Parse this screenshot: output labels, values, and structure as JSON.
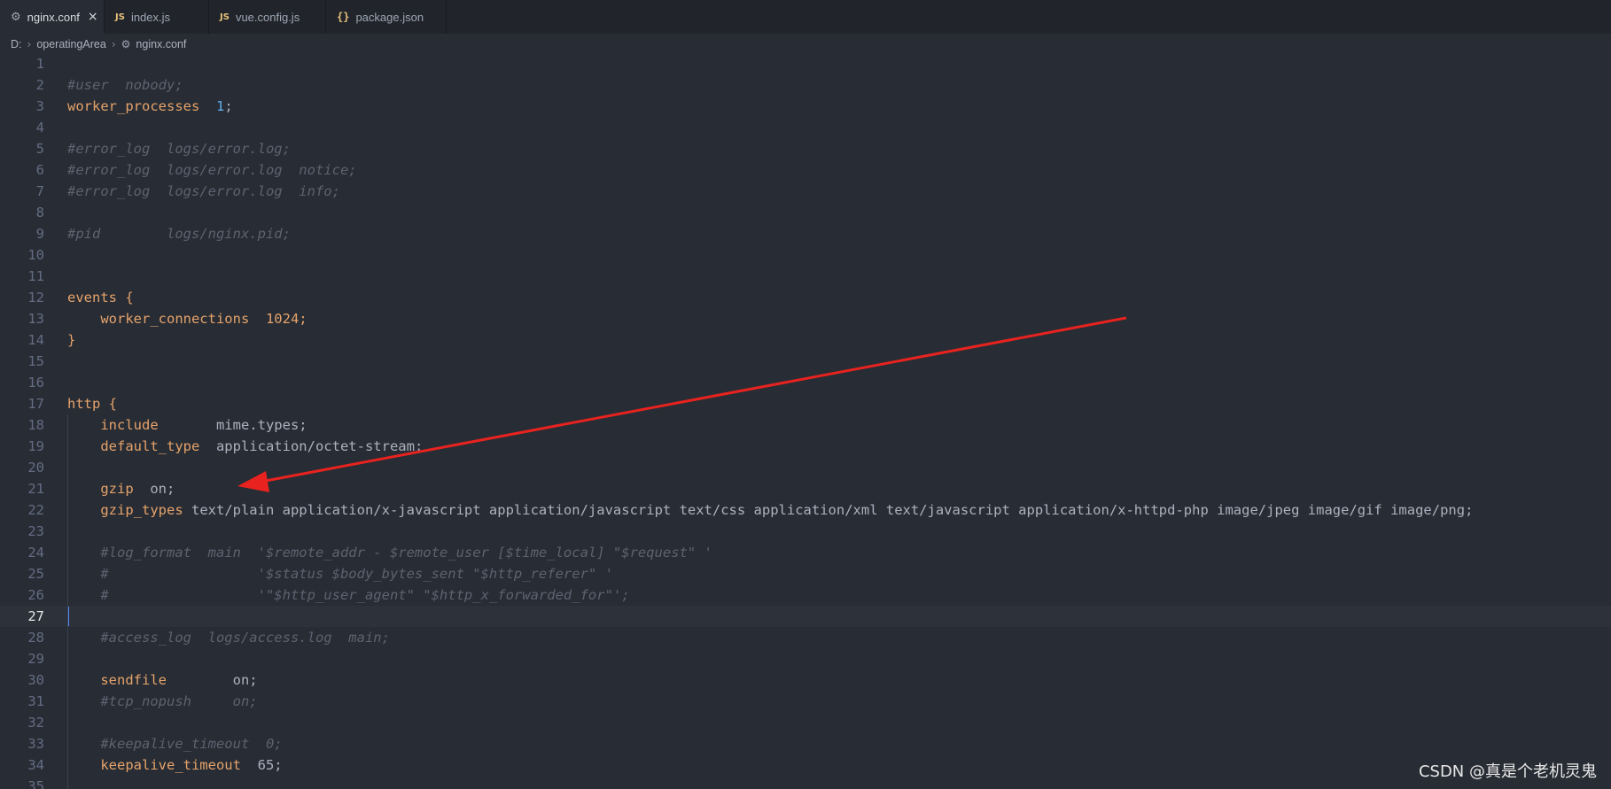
{
  "tabs": [
    {
      "icon": "gear-icon",
      "glyph": "⚙",
      "label": "nginx.conf",
      "active": true,
      "close": "×"
    },
    {
      "icon": "js-file-icon",
      "glyph": "JS",
      "label": "index.js",
      "active": false
    },
    {
      "icon": "js-file-icon",
      "glyph": "JS",
      "label": "vue.config.js",
      "active": false
    },
    {
      "icon": "json-file-icon",
      "glyph": "{}",
      "label": "package.json",
      "active": false
    }
  ],
  "breadcrumb": {
    "drive": "D:",
    "folder": "operatingArea",
    "file": "nginx.conf",
    "separator": "›",
    "file_icon": "⚙"
  },
  "editor": {
    "current_line": 27,
    "lines": [
      {
        "n": "1",
        "parts": []
      },
      {
        "n": "2",
        "parts": [
          {
            "t": "#user  nobody;",
            "s": "c"
          }
        ]
      },
      {
        "n": "3",
        "parts": [
          {
            "t": "worker_processes",
            "s": "k"
          },
          {
            "t": "  ",
            "s": "p"
          },
          {
            "t": "1",
            "s": "n"
          },
          {
            "t": ";",
            "s": "p"
          }
        ]
      },
      {
        "n": "4",
        "parts": []
      },
      {
        "n": "5",
        "parts": [
          {
            "t": "#error_log  logs/error.log;",
            "s": "c"
          }
        ]
      },
      {
        "n": "6",
        "parts": [
          {
            "t": "#error_log  logs/error.log  notice;",
            "s": "c"
          }
        ]
      },
      {
        "n": "7",
        "parts": [
          {
            "t": "#error_log  logs/error.log  info;",
            "s": "c"
          }
        ]
      },
      {
        "n": "8",
        "parts": []
      },
      {
        "n": "9",
        "parts": [
          {
            "t": "#pid        logs/nginx.pid;",
            "s": "c"
          }
        ]
      },
      {
        "n": "10",
        "parts": []
      },
      {
        "n": "11",
        "parts": []
      },
      {
        "n": "12",
        "parts": [
          {
            "t": "events {",
            "s": "k"
          }
        ]
      },
      {
        "n": "13",
        "parts": [
          {
            "t": "    ",
            "s": "p"
          },
          {
            "t": "worker_connections",
            "s": "k"
          },
          {
            "t": "  1024;",
            "s": "k"
          }
        ]
      },
      {
        "n": "14",
        "parts": [
          {
            "t": "}",
            "s": "k"
          }
        ]
      },
      {
        "n": "15",
        "parts": []
      },
      {
        "n": "16",
        "parts": []
      },
      {
        "n": "17",
        "parts": [
          {
            "t": "http {",
            "s": "k"
          }
        ]
      },
      {
        "n": "18",
        "parts": [
          {
            "t": "    ",
            "s": "p"
          },
          {
            "t": "include",
            "s": "k"
          },
          {
            "t": "       mime.types;",
            "s": "p"
          }
        ]
      },
      {
        "n": "19",
        "parts": [
          {
            "t": "    ",
            "s": "p"
          },
          {
            "t": "default_type",
            "s": "k"
          },
          {
            "t": "  application/octet-stream;",
            "s": "p"
          }
        ]
      },
      {
        "n": "20",
        "parts": []
      },
      {
        "n": "21",
        "parts": [
          {
            "t": "    ",
            "s": "p"
          },
          {
            "t": "gzip",
            "s": "k"
          },
          {
            "t": "  on;",
            "s": "p"
          }
        ]
      },
      {
        "n": "22",
        "parts": [
          {
            "t": "    ",
            "s": "p"
          },
          {
            "t": "gzip_types",
            "s": "k"
          },
          {
            "t": " text/plain application/x-javascript application/javascript text/css application/xml text/javascript application/x-httpd-php image/jpeg image/gif image/png;",
            "s": "p"
          }
        ]
      },
      {
        "n": "23",
        "parts": []
      },
      {
        "n": "24",
        "parts": [
          {
            "t": "    ",
            "s": "p"
          },
          {
            "t": "#log_format  main  '$remote_addr - $remote_user [$time_local] \"$request\" '",
            "s": "c"
          }
        ]
      },
      {
        "n": "25",
        "parts": [
          {
            "t": "    ",
            "s": "p"
          },
          {
            "t": "#                  '$status $body_bytes_sent \"$http_referer\" '",
            "s": "c"
          }
        ]
      },
      {
        "n": "26",
        "parts": [
          {
            "t": "    ",
            "s": "p"
          },
          {
            "t": "#                  '\"$http_user_agent\" \"$http_x_forwarded_for\"';",
            "s": "c"
          }
        ]
      },
      {
        "n": "27",
        "parts": []
      },
      {
        "n": "28",
        "parts": [
          {
            "t": "    ",
            "s": "p"
          },
          {
            "t": "#access_log  logs/access.log  main;",
            "s": "c"
          }
        ]
      },
      {
        "n": "29",
        "parts": []
      },
      {
        "n": "30",
        "parts": [
          {
            "t": "    ",
            "s": "p"
          },
          {
            "t": "sendfile",
            "s": "k"
          },
          {
            "t": "        on;",
            "s": "p"
          }
        ]
      },
      {
        "n": "31",
        "parts": [
          {
            "t": "    ",
            "s": "p"
          },
          {
            "t": "#tcp_nopush     on;",
            "s": "c"
          }
        ]
      },
      {
        "n": "32",
        "parts": []
      },
      {
        "n": "33",
        "parts": [
          {
            "t": "    ",
            "s": "p"
          },
          {
            "t": "#keepalive_timeout  0;",
            "s": "c"
          }
        ]
      },
      {
        "n": "34",
        "parts": [
          {
            "t": "    ",
            "s": "p"
          },
          {
            "t": "keepalive_timeout",
            "s": "k"
          },
          {
            "t": "  65;",
            "s": "p"
          }
        ]
      },
      {
        "n": "35",
        "parts": []
      }
    ]
  },
  "annotation": {
    "color": "#e8231f"
  },
  "watermark": "CSDN @真是个老机灵鬼",
  "colors": {
    "background": "#282c34",
    "tabbar": "#21252b",
    "keyword": "#e5a36b",
    "number": "#61afef",
    "comment": "#5c6370",
    "cursor": "#528bff"
  }
}
